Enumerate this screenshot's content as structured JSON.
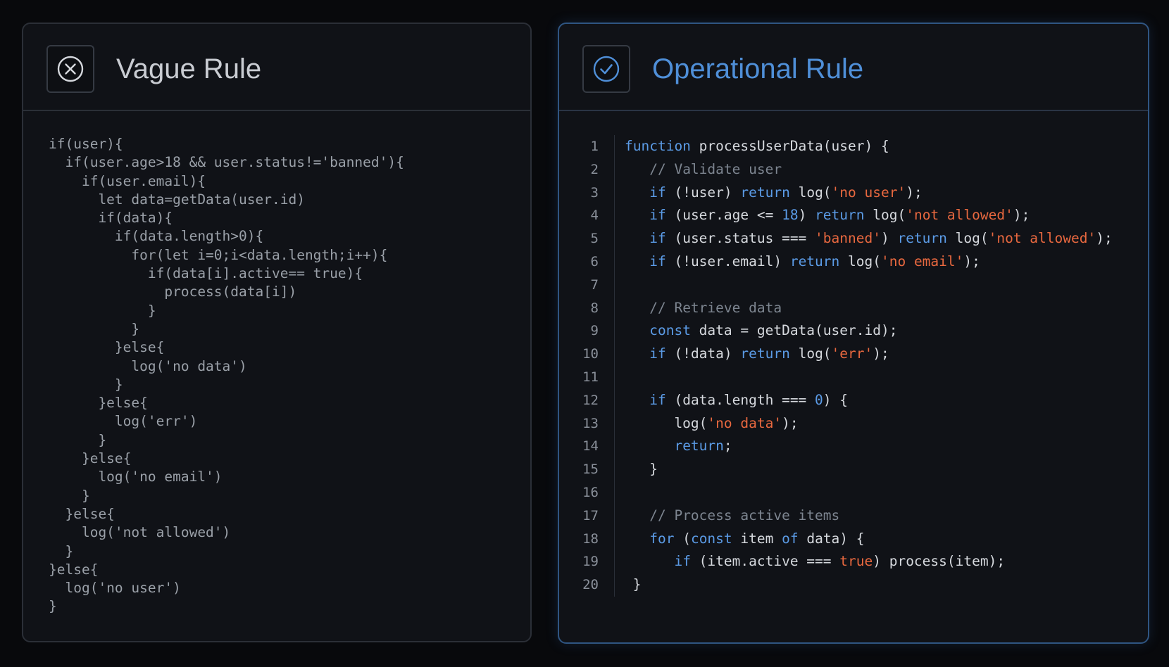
{
  "left_panel": {
    "title": "Vague Rule",
    "icon": "x-circle-icon",
    "code_lines": [
      "if(user){",
      "  if(user.age>18 && user.status!='banned'){",
      "    if(user.email){",
      "      let data=getData(user.id)",
      "      if(data){",
      "        if(data.length>0){",
      "          for(let i=0;i<data.length;i++){",
      "            if(data[i].active== true){",
      "              process(data[i])",
      "            }",
      "          }",
      "        }else{",
      "          log('no data')",
      "        }",
      "      }else{",
      "        log('err')",
      "      }",
      "    }else{",
      "      log('no email')",
      "    }",
      "  }else{",
      "    log('not allowed')",
      "  }",
      "}else{",
      "  log('no user')",
      "}"
    ]
  },
  "right_panel": {
    "title": "Operational Rule",
    "icon": "check-circle-icon",
    "line_numbers": [
      "1",
      "2",
      "3",
      "4",
      "5",
      "6",
      "7",
      "8",
      "9",
      "10",
      "11",
      "12",
      "13",
      "14",
      "15",
      "16",
      "17",
      "18",
      "19",
      "20"
    ],
    "code_lines": [
      [
        [
          "kw",
          "function"
        ],
        [
          "plain",
          " processUserData(user) {"
        ]
      ],
      [
        [
          "plain",
          "   "
        ],
        [
          "com",
          "// Validate user"
        ]
      ],
      [
        [
          "plain",
          "   "
        ],
        [
          "kw",
          "if"
        ],
        [
          "plain",
          " (!user) "
        ],
        [
          "kw",
          "return"
        ],
        [
          "plain",
          " log("
        ],
        [
          "str",
          "'no user'"
        ],
        [
          "plain",
          ");"
        ]
      ],
      [
        [
          "plain",
          "   "
        ],
        [
          "kw",
          "if"
        ],
        [
          "plain",
          " (user.age <= "
        ],
        [
          "num",
          "18"
        ],
        [
          "plain",
          ") "
        ],
        [
          "kw",
          "return"
        ],
        [
          "plain",
          " log("
        ],
        [
          "str",
          "'not allowed'"
        ],
        [
          "plain",
          ");"
        ]
      ],
      [
        [
          "plain",
          "   "
        ],
        [
          "kw",
          "if"
        ],
        [
          "plain",
          " (user.status === "
        ],
        [
          "str",
          "'banned'"
        ],
        [
          "plain",
          ") "
        ],
        [
          "kw",
          "return"
        ],
        [
          "plain",
          " log("
        ],
        [
          "str",
          "'not allowed'"
        ],
        [
          "plain",
          ");"
        ]
      ],
      [
        [
          "plain",
          "   "
        ],
        [
          "kw",
          "if"
        ],
        [
          "plain",
          " (!user.email) "
        ],
        [
          "kw",
          "return"
        ],
        [
          "plain",
          " log("
        ],
        [
          "str",
          "'no email'"
        ],
        [
          "plain",
          ");"
        ]
      ],
      [],
      [
        [
          "plain",
          "   "
        ],
        [
          "com",
          "// Retrieve data"
        ]
      ],
      [
        [
          "plain",
          "   "
        ],
        [
          "kw",
          "const"
        ],
        [
          "plain",
          " data = getData(user.id);"
        ]
      ],
      [
        [
          "plain",
          "   "
        ],
        [
          "kw",
          "if"
        ],
        [
          "plain",
          " (!data) "
        ],
        [
          "kw",
          "return"
        ],
        [
          "plain",
          " log("
        ],
        [
          "str",
          "'err'"
        ],
        [
          "plain",
          ");"
        ]
      ],
      [],
      [
        [
          "plain",
          "   "
        ],
        [
          "kw",
          "if"
        ],
        [
          "plain",
          " (data.length === "
        ],
        [
          "num",
          "0"
        ],
        [
          "plain",
          ") {"
        ]
      ],
      [
        [
          "plain",
          "      log("
        ],
        [
          "str",
          "'no data'"
        ],
        [
          "plain",
          ");"
        ]
      ],
      [
        [
          "plain",
          "      "
        ],
        [
          "kw",
          "return"
        ],
        [
          "plain",
          ";"
        ]
      ],
      [
        [
          "plain",
          "   }"
        ]
      ],
      [],
      [
        [
          "plain",
          "   "
        ],
        [
          "com",
          "// Process active items"
        ]
      ],
      [
        [
          "plain",
          "   "
        ],
        [
          "kw",
          "for"
        ],
        [
          "plain",
          " ("
        ],
        [
          "kw",
          "const"
        ],
        [
          "plain",
          " item "
        ],
        [
          "kw",
          "of"
        ],
        [
          "plain",
          " data) {"
        ]
      ],
      [
        [
          "plain",
          "      "
        ],
        [
          "kw",
          "if"
        ],
        [
          "plain",
          " (item.active === "
        ],
        [
          "str",
          "true"
        ],
        [
          "plain",
          ") process(item);"
        ]
      ],
      [
        [
          "plain",
          " }"
        ]
      ]
    ]
  },
  "colors": {
    "keyword": "#5b9be6",
    "string": "#e8683f",
    "comment": "#7d8590",
    "accent": "#4f8fd8"
  }
}
